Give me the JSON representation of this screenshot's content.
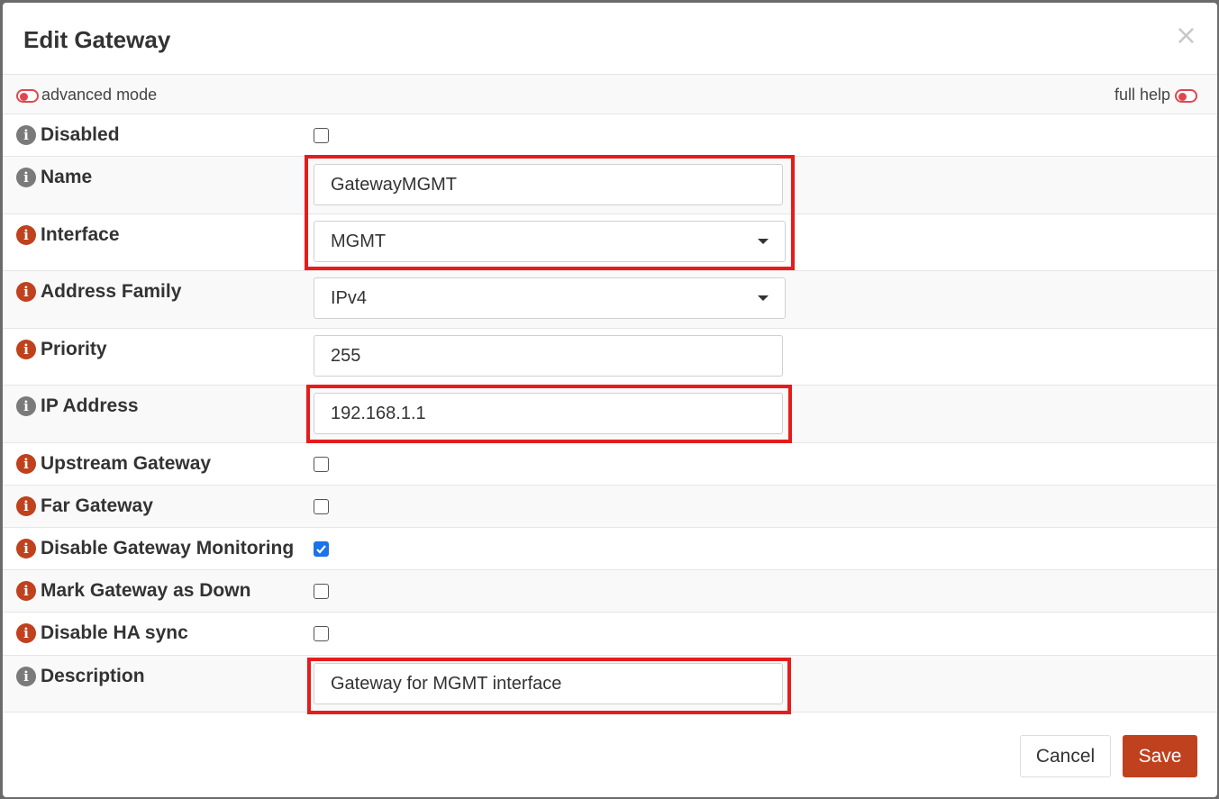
{
  "dialog": {
    "title": "Edit Gateway",
    "close_label": "×"
  },
  "toggles": {
    "advanced_mode": "advanced mode",
    "full_help": "full help"
  },
  "fields": {
    "disabled": {
      "label": "Disabled",
      "checked": false
    },
    "name": {
      "label": "Name",
      "value": "GatewayMGMT"
    },
    "interface": {
      "label": "Interface",
      "value": "MGMT"
    },
    "address_family": {
      "label": "Address Family",
      "value": "IPv4"
    },
    "priority": {
      "label": "Priority",
      "value": "255"
    },
    "ip_address": {
      "label": "IP Address",
      "value": "192.168.1.1"
    },
    "upstream_gateway": {
      "label": "Upstream Gateway",
      "checked": false
    },
    "far_gateway": {
      "label": "Far Gateway",
      "checked": false
    },
    "disable_gateway_monitoring": {
      "label": "Disable Gateway Monitoring",
      "checked": true
    },
    "mark_gateway_down": {
      "label": "Mark Gateway as Down",
      "checked": false
    },
    "disable_ha_sync": {
      "label": "Disable HA sync",
      "checked": false
    },
    "description": {
      "label": "Description",
      "value": "Gateway for MGMT interface"
    }
  },
  "footer": {
    "cancel_label": "Cancel",
    "save_label": "Save"
  },
  "colors": {
    "accent": "#c0411d",
    "highlight": "#e51c1c",
    "checkbox_checked": "#1a73e8",
    "info_neutral": "#7a7a7a"
  },
  "icons": {
    "info": "info-icon",
    "toggle": "toggle-icon",
    "close": "close-icon",
    "caret": "chevron-down-icon"
  }
}
